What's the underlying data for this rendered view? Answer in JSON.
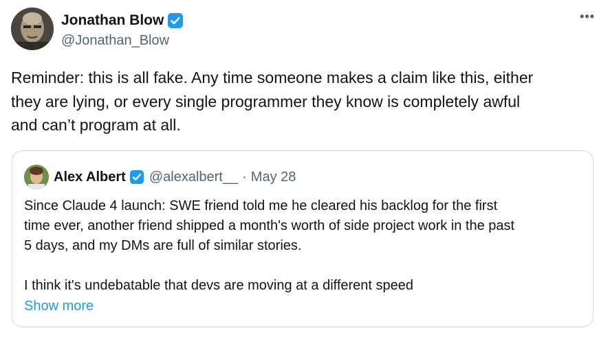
{
  "tweet": {
    "author_name": "Jonathan Blow",
    "author_handle": "@Jonathan_Blow",
    "more_label": "•••",
    "text_lines": [
      "Reminder: this is all fake. Any time someone makes a claim like this, either",
      "they are lying, or every single programmer they know is completely awful",
      "and can’t program at all."
    ]
  },
  "quote": {
    "author_name": "Alex Albert",
    "author_handle": "@alexalbert__",
    "separator": "·",
    "date": "May 28",
    "text_lines": [
      "Since Claude 4 launch: SWE friend told me he cleared his backlog for the first",
      "time ever, another friend shipped a month's worth of side project work in the past",
      "5 days, and my DMs are full of similar stories.",
      "",
      "I think it's undebatable that devs are moving at a different speed"
    ],
    "show_more_label": "Show more"
  },
  "colors": {
    "verified_badge": "#1d9bf0",
    "link": "#1d9bf0",
    "secondary_text": "#536471",
    "border": "#cfd9de"
  }
}
